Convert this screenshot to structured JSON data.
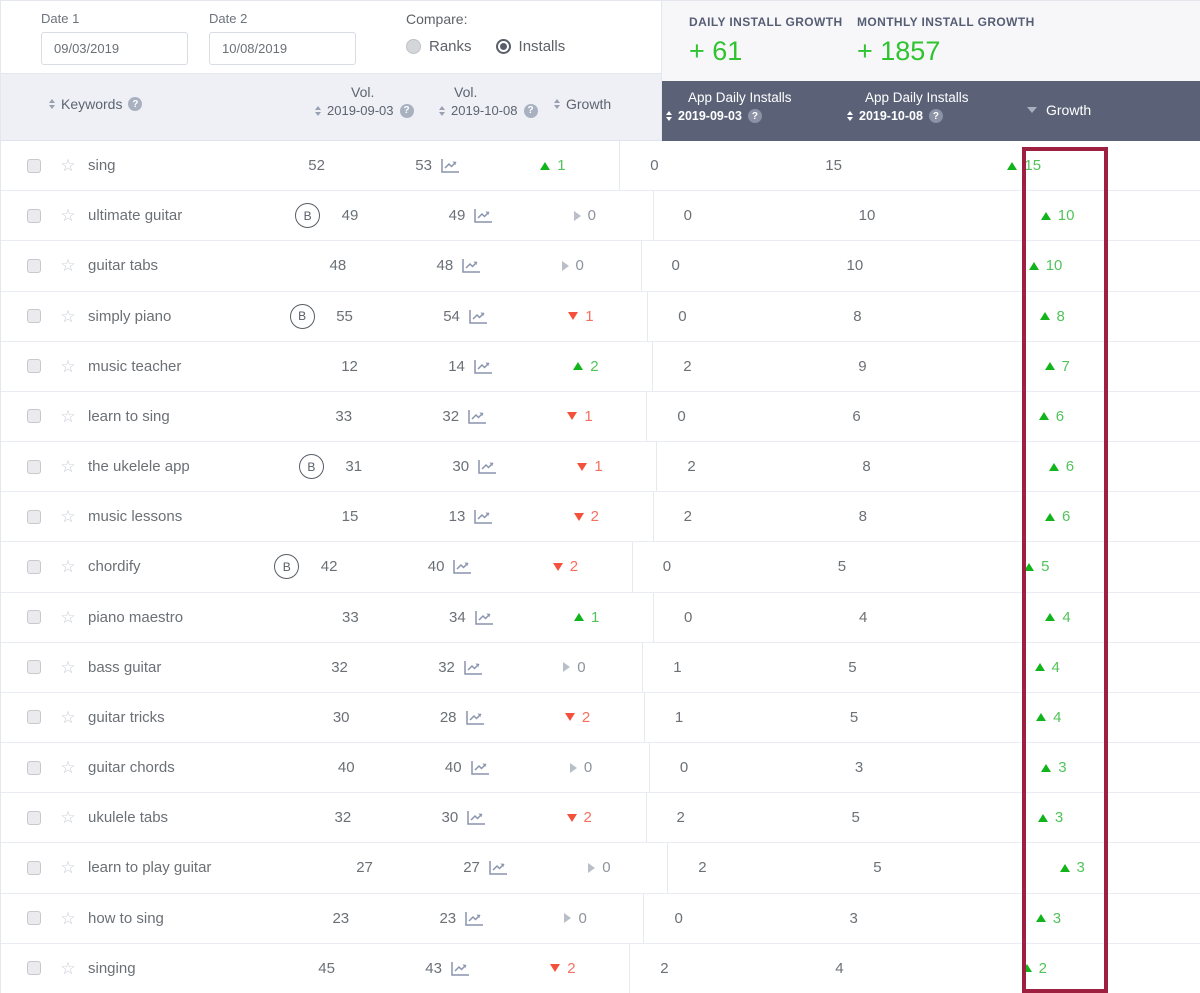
{
  "filters": {
    "date1_label": "Date 1",
    "date1_value": "09/03/2019",
    "date2_label": "Date 2",
    "date2_value": "10/08/2019",
    "compare_label": "Compare:",
    "options": [
      {
        "label": "Ranks",
        "selected": false
      },
      {
        "label": "Installs",
        "selected": true
      }
    ]
  },
  "stats": {
    "daily": {
      "label": "DAILY INSTALL GROWTH",
      "value": "+ 61"
    },
    "monthly": {
      "label": "MONTHLY INSTALL GROWTH",
      "value": "+ 1857"
    },
    "value_color": "#2fc42f"
  },
  "icons": {
    "star": "☆",
    "question": "?",
    "badge_b": "B"
  },
  "table": {
    "headers": {
      "keywords": "Keywords",
      "vol1_line1": "Vol.",
      "vol1_line2": "2019-09-03",
      "vol2_line1": "Vol.",
      "vol2_line2": "2019-10-08",
      "growth": "Growth",
      "installs1_line1": "App Daily Installs",
      "installs1_line2": "2019-09-03",
      "installs2_line1": "App Daily Installs",
      "installs2_line2": "2019-10-08",
      "installs_growth": "Growth"
    },
    "rows": [
      {
        "keyword": "sing",
        "badge": false,
        "vol1": "52",
        "vol2": "53",
        "vol_growth": "1",
        "vol_dir": "up",
        "installs1": "0",
        "installs2": "15",
        "installs_growth": "15",
        "installs_dir": "up"
      },
      {
        "keyword": "ultimate guitar",
        "badge": true,
        "vol1": "49",
        "vol2": "49",
        "vol_growth": "0",
        "vol_dir": "zero",
        "installs1": "0",
        "installs2": "10",
        "installs_growth": "10",
        "installs_dir": "up"
      },
      {
        "keyword": "guitar tabs",
        "badge": false,
        "vol1": "48",
        "vol2": "48",
        "vol_growth": "0",
        "vol_dir": "zero",
        "installs1": "0",
        "installs2": "10",
        "installs_growth": "10",
        "installs_dir": "up"
      },
      {
        "keyword": "simply piano",
        "badge": true,
        "vol1": "55",
        "vol2": "54",
        "vol_growth": "1",
        "vol_dir": "down",
        "installs1": "0",
        "installs2": "8",
        "installs_growth": "8",
        "installs_dir": "up"
      },
      {
        "keyword": "music teacher",
        "badge": false,
        "vol1": "12",
        "vol2": "14",
        "vol_growth": "2",
        "vol_dir": "up",
        "installs1": "2",
        "installs2": "9",
        "installs_growth": "7",
        "installs_dir": "up"
      },
      {
        "keyword": "learn to sing",
        "badge": false,
        "vol1": "33",
        "vol2": "32",
        "vol_growth": "1",
        "vol_dir": "down",
        "installs1": "0",
        "installs2": "6",
        "installs_growth": "6",
        "installs_dir": "up"
      },
      {
        "keyword": "the ukelele app",
        "badge": true,
        "vol1": "31",
        "vol2": "30",
        "vol_growth": "1",
        "vol_dir": "down",
        "installs1": "2",
        "installs2": "8",
        "installs_growth": "6",
        "installs_dir": "up"
      },
      {
        "keyword": "music lessons",
        "badge": false,
        "vol1": "15",
        "vol2": "13",
        "vol_growth": "2",
        "vol_dir": "down",
        "installs1": "2",
        "installs2": "8",
        "installs_growth": "6",
        "installs_dir": "up"
      },
      {
        "keyword": "chordify",
        "badge": true,
        "vol1": "42",
        "vol2": "40",
        "vol_growth": "2",
        "vol_dir": "down",
        "installs1": "0",
        "installs2": "5",
        "installs_growth": "5",
        "installs_dir": "up"
      },
      {
        "keyword": "piano maestro",
        "badge": false,
        "vol1": "33",
        "vol2": "34",
        "vol_growth": "1",
        "vol_dir": "up",
        "installs1": "0",
        "installs2": "4",
        "installs_growth": "4",
        "installs_dir": "up"
      },
      {
        "keyword": "bass guitar",
        "badge": false,
        "vol1": "32",
        "vol2": "32",
        "vol_growth": "0",
        "vol_dir": "zero",
        "installs1": "1",
        "installs2": "5",
        "installs_growth": "4",
        "installs_dir": "up"
      },
      {
        "keyword": "guitar tricks",
        "badge": false,
        "vol1": "30",
        "vol2": "28",
        "vol_growth": "2",
        "vol_dir": "down",
        "installs1": "1",
        "installs2": "5",
        "installs_growth": "4",
        "installs_dir": "up"
      },
      {
        "keyword": "guitar chords",
        "badge": false,
        "vol1": "40",
        "vol2": "40",
        "vol_growth": "0",
        "vol_dir": "zero",
        "installs1": "0",
        "installs2": "3",
        "installs_growth": "3",
        "installs_dir": "up"
      },
      {
        "keyword": "ukulele tabs",
        "badge": false,
        "vol1": "32",
        "vol2": "30",
        "vol_growth": "2",
        "vol_dir": "down",
        "installs1": "2",
        "installs2": "5",
        "installs_growth": "3",
        "installs_dir": "up"
      },
      {
        "keyword": "learn to play guitar",
        "badge": false,
        "vol1": "27",
        "vol2": "27",
        "vol_growth": "0",
        "vol_dir": "zero",
        "installs1": "2",
        "installs2": "5",
        "installs_growth": "3",
        "installs_dir": "up"
      },
      {
        "keyword": "how to sing",
        "badge": false,
        "vol1": "23",
        "vol2": "23",
        "vol_growth": "0",
        "vol_dir": "zero",
        "installs1": "0",
        "installs2": "3",
        "installs_growth": "3",
        "installs_dir": "up"
      },
      {
        "keyword": "singing",
        "badge": false,
        "vol1": "45",
        "vol2": "43",
        "vol_growth": "2",
        "vol_dir": "down",
        "installs1": "2",
        "installs2": "4",
        "installs_growth": "2",
        "installs_dir": "up"
      }
    ]
  },
  "highlight": {
    "color": "#9d2040"
  }
}
